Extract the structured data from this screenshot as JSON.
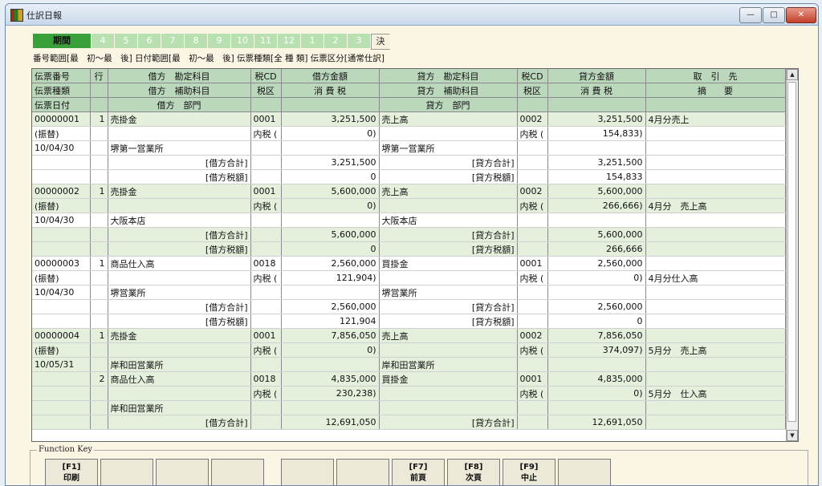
{
  "window": {
    "title": "仕訳日報"
  },
  "period_bar": {
    "label": "期間",
    "months": [
      "4",
      "5",
      "6",
      "7",
      "8",
      "9",
      "10",
      "11",
      "12",
      "1",
      "2",
      "3"
    ],
    "final": "決"
  },
  "filter_line": "番号範囲[最　初～最　後] 日付範囲[最　初～最　後] 伝票種類[全 種 類] 伝票区分[通常仕訳]",
  "grid": {
    "header_rows": [
      [
        "伝票番号",
        "行",
        "借方　勘定科目",
        "税CD",
        "借方金額",
        "貸方　勘定科目",
        "税CD",
        "貸方金額",
        "取　引　先"
      ],
      [
        "伝票種類",
        "",
        "借方　補助科目",
        "税区",
        "消 費 税",
        "貸方　補助科目",
        "税区",
        "消 費 税",
        "摘　　要"
      ],
      [
        "伝票日付",
        "",
        "借方　部門",
        "",
        "",
        "貸方　部門",
        "",
        "",
        ""
      ]
    ],
    "rows": [
      [
        "00000001",
        "1",
        "売掛金",
        "0001",
        "3,251,500",
        "売上高",
        "0002",
        "3,251,500",
        "4月分売上"
      ],
      [
        "(振替)",
        "",
        "",
        "内税 (",
        "0)",
        "",
        "内税 (",
        "154,833)",
        ""
      ],
      [
        "10/04/30",
        "",
        "堺第一営業所",
        "",
        "",
        "堺第一営業所",
        "",
        "",
        ""
      ],
      [
        "",
        "",
        "[借方合計]",
        "",
        "3,251,500",
        "[貸方合計]",
        "",
        "3,251,500",
        ""
      ],
      [
        "",
        "",
        "[借方税額]",
        "",
        "0",
        "[貸方税額]",
        "",
        "154,833",
        ""
      ],
      [
        "00000002",
        "1",
        "売掛金",
        "0001",
        "5,600,000",
        "売上高",
        "0002",
        "5,600,000",
        ""
      ],
      [
        "(振替)",
        "",
        "",
        "内税 (",
        "0)",
        "",
        "内税 (",
        "266,666)",
        "4月分　売上高"
      ],
      [
        "10/04/30",
        "",
        "大阪本店",
        "",
        "",
        "大阪本店",
        "",
        "",
        ""
      ],
      [
        "",
        "",
        "[借方合計]",
        "",
        "5,600,000",
        "[貸方合計]",
        "",
        "5,600,000",
        ""
      ],
      [
        "",
        "",
        "[借方税額]",
        "",
        "0",
        "[貸方税額]",
        "",
        "266,666",
        ""
      ],
      [
        "00000003",
        "1",
        "商品仕入高",
        "0018",
        "2,560,000",
        "買掛金",
        "0001",
        "2,560,000",
        ""
      ],
      [
        "(振替)",
        "",
        "",
        "内税 (",
        "121,904)",
        "",
        "内税 (",
        "0)",
        "4月分仕入高"
      ],
      [
        "10/04/30",
        "",
        "堺営業所",
        "",
        "",
        "堺営業所",
        "",
        "",
        ""
      ],
      [
        "",
        "",
        "[借方合計]",
        "",
        "2,560,000",
        "[貸方合計]",
        "",
        "2,560,000",
        ""
      ],
      [
        "",
        "",
        "[借方税額]",
        "",
        "121,904",
        "[貸方税額]",
        "",
        "0",
        ""
      ],
      [
        "00000004",
        "1",
        "売掛金",
        "0001",
        "7,856,050",
        "売上高",
        "0002",
        "7,856,050",
        ""
      ],
      [
        "(振替)",
        "",
        "",
        "内税 (",
        "0)",
        "",
        "内税 (",
        "374,097)",
        "5月分　売上高"
      ],
      [
        "10/05/31",
        "",
        "岸和田営業所",
        "",
        "",
        "岸和田営業所",
        "",
        "",
        ""
      ],
      [
        "",
        "2",
        "商品仕入高",
        "0018",
        "4,835,000",
        "買掛金",
        "0001",
        "4,835,000",
        ""
      ],
      [
        "",
        "",
        "",
        "内税 (",
        "230,238)",
        "",
        "内税 (",
        "0)",
        "5月分　仕入高"
      ],
      [
        "",
        "",
        "岸和田営業所",
        "",
        "",
        "",
        "",
        "",
        ""
      ],
      [
        "",
        "",
        "[借方合計]",
        "",
        "12,691,050",
        "[貸方合計]",
        "",
        "12,691,050",
        ""
      ]
    ],
    "row_shading": [
      "g",
      "w",
      "w",
      "w",
      "w",
      "g",
      "g",
      "w",
      "g",
      "g",
      "w",
      "w",
      "w",
      "w",
      "w",
      "g",
      "g",
      "g",
      "g",
      "g",
      "g",
      "g"
    ]
  },
  "function_keys": {
    "legend": "Function Key",
    "keys": [
      {
        "code": "[F1]",
        "label": "印刷"
      },
      {
        "code": "",
        "label": ""
      },
      {
        "code": "",
        "label": ""
      },
      {
        "code": "",
        "label": ""
      },
      {
        "code": "",
        "label": ""
      },
      {
        "code": "",
        "label": ""
      },
      {
        "code": "[F7]",
        "label": "前頁"
      },
      {
        "code": "[F8]",
        "label": "次頁"
      },
      {
        "code": "[F9]",
        "label": "中止"
      },
      {
        "code": "",
        "label": ""
      }
    ]
  }
}
